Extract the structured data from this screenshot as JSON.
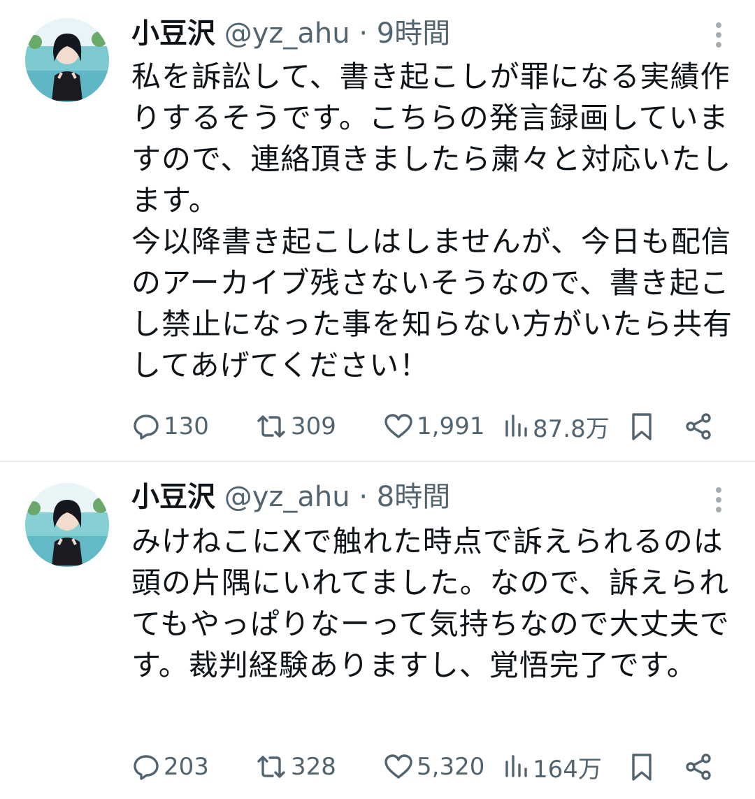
{
  "tweets": [
    {
      "author": {
        "name": "小豆沢",
        "handle": "@yz_ahu",
        "separator": "·",
        "time": "9時間"
      },
      "paragraphs": [
        "私を訴訟して、書き起こしが罪になる実績作りするそうです。こちらの発言録画していますので、連絡頂きましたら粛々と対応いたします。",
        "今以降書き起こしはしませんが、今日も配信のアーカイブ残さないそうなので、書き起こし禁止になった事を知らない方がいたら共有してあげてください！"
      ],
      "stats": {
        "replies": "130",
        "reposts": "309",
        "likes": "1,991",
        "views": "87.8万"
      }
    },
    {
      "author": {
        "name": "小豆沢",
        "handle": "@yz_ahu",
        "separator": "·",
        "time": "8時間"
      },
      "paragraphs": [
        "みけねこにXで触れた時点で訴えられるのは頭の片隅にいれてました。なので、訴えられてもやっぱりなーって気持ちなので大丈夫です。裁判経験ありますし、覚悟完了です。"
      ],
      "stats": {
        "replies": "203",
        "reposts": "328",
        "likes": "5,320",
        "views": "164万"
      }
    }
  ],
  "icons": {
    "more": "more-vertical-icon",
    "reply": "reply-icon",
    "repost": "repost-icon",
    "like": "heart-icon",
    "views": "views-chart-icon",
    "bookmark": "bookmark-icon",
    "share": "share-icon"
  },
  "colors": {
    "text": "#0f1419",
    "secondary": "#536471",
    "divider": "#e7eaec"
  }
}
